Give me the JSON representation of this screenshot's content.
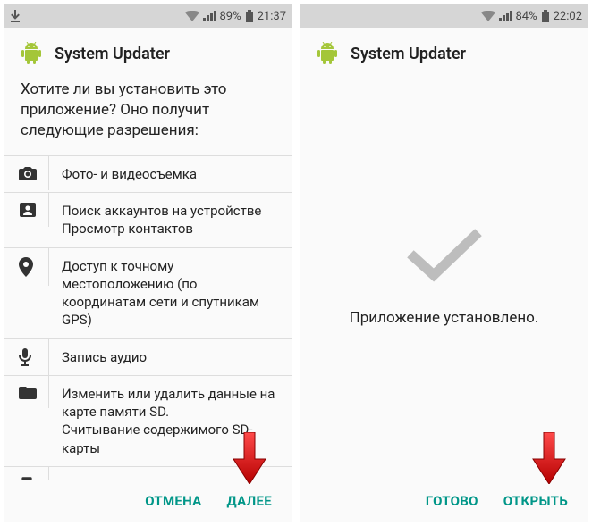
{
  "colors": {
    "accent": "#009688",
    "arrow": "#e21b1b",
    "android": "#a4c639"
  },
  "left": {
    "statusbar": {
      "battery": "89%",
      "time": "21:37"
    },
    "app_title": "System Updater",
    "prompt": "Хотите ли вы установить это приложение? Оно получит следующие разрешения:",
    "permissions": [
      {
        "icon": "camera",
        "text": "Фото- и видеосъемка"
      },
      {
        "icon": "contacts",
        "text": "Поиск аккаунтов на устройстве\nПросмотр контактов"
      },
      {
        "icon": "location",
        "text": "Доступ к точному местоположению (по координатам сети и спутникам GPS)"
      },
      {
        "icon": "microphone",
        "text": "Запись аудио"
      },
      {
        "icon": "storage",
        "text": "Изменить или удалить данные на карте памяти SD.\nСчитывание содержимого SD-карты"
      }
    ],
    "buttons": {
      "cancel": "ОТМЕНА",
      "next": "ДАЛЕЕ"
    }
  },
  "right": {
    "statusbar": {
      "battery": "84%",
      "time": "22:02"
    },
    "app_title": "System Updater",
    "done_text": "Приложение установлено.",
    "buttons": {
      "done": "ГОТОВО",
      "open": "ОТКРЫТЬ"
    }
  }
}
